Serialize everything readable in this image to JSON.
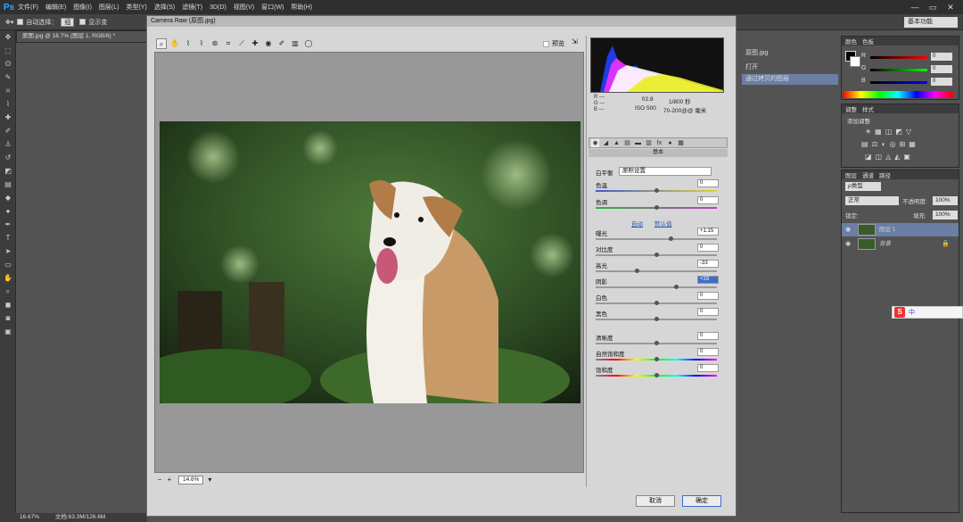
{
  "app": {
    "logo": "Ps",
    "win_min": "—",
    "win_max": "▭",
    "win_close": "✕"
  },
  "menu": [
    "文件(F)",
    "编辑(E)",
    "图像(I)",
    "图层(L)",
    "类型(Y)",
    "选择(S)",
    "滤镜(T)",
    "3D(D)",
    "视图(V)",
    "窗口(W)",
    "帮助(H)"
  ],
  "options": {
    "auto_select_label": "自动选择：",
    "auto_select_value": "组",
    "show_transform_label": "显示变"
  },
  "workspace": "基本功能",
  "doc_tab": "原图.jpg @ 16.7% (图层 1, RGB/8) *",
  "statusbar": {
    "zoom": "16.67%",
    "doc": "文档:63.3M/126.6M"
  },
  "dialog": {
    "title": "Camera Raw (原图.jpg)",
    "preview_label": "预览",
    "zoom": "14.6%",
    "rgb": {
      "r": "R ---",
      "g": "G ---",
      "b": "B ---"
    },
    "meta": {
      "aperture": "f/2.8",
      "shutter": "1/800 秒",
      "iso": "ISO 500",
      "lens": "70-200@@ 毫米"
    },
    "panel_title": "基本",
    "wb_label": "白平衡",
    "wb_value": "原照设置",
    "links": {
      "auto": "自动",
      "default": "默认值"
    },
    "sliders": [
      {
        "label": "色温",
        "value": "0"
      },
      {
        "label": "色调",
        "value": "0"
      },
      {
        "label": "曝光",
        "value": "+1.15"
      },
      {
        "label": "对比度",
        "value": "0"
      },
      {
        "label": "高光",
        "value": "-33"
      },
      {
        "label": "阴影",
        "value": "+33"
      },
      {
        "label": "白色",
        "value": "0"
      },
      {
        "label": "黑色",
        "value": "0"
      },
      {
        "label": "清晰度",
        "value": "0"
      },
      {
        "label": "自然饱和度",
        "value": "0"
      },
      {
        "label": "饱和度",
        "value": "0"
      }
    ],
    "cancel": "取消",
    "ok": "确定"
  },
  "history": {
    "file": "原图.jpg",
    "open": "打开",
    "item": "通过拷贝的图层"
  },
  "color_panel": {
    "tab1": "颜色",
    "tab2": "色板",
    "r": "R",
    "g": "G",
    "b": "B",
    "r_val": "0",
    "g_val": "0",
    "b_val": "0"
  },
  "adjust_panel": {
    "tab1": "调整",
    "tab2": "样式",
    "title": "添加调整"
  },
  "layers_panel": {
    "tabs": [
      "图层",
      "通道",
      "路径"
    ],
    "kind": "ρ类型",
    "blend": "正常",
    "opacity_label": "不透明度:",
    "opacity": "100%",
    "lock_label": "锁定:",
    "fill_label": "填充:",
    "fill": "100%",
    "layers": [
      {
        "name": "图层 1"
      },
      {
        "name": "背景"
      }
    ]
  },
  "ime": {
    "s": "S",
    "zh": "中"
  }
}
